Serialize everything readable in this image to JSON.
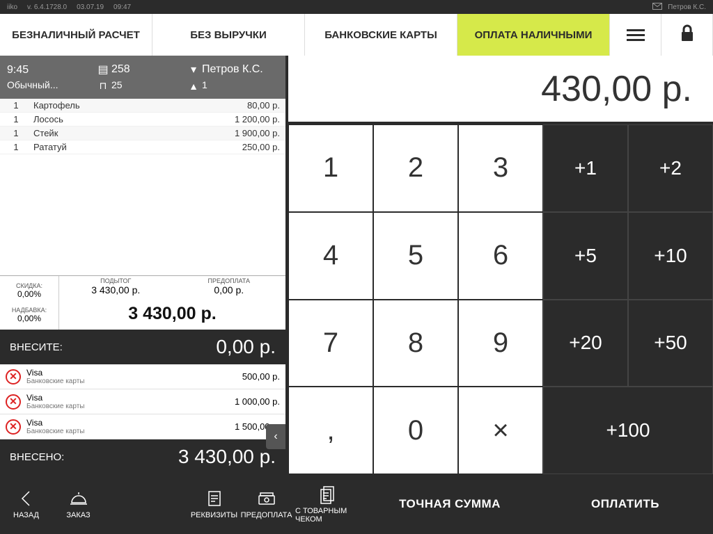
{
  "status": {
    "app": "iiko",
    "version": "v. 6.4.1728.0",
    "date": "03.07.19",
    "time": "09:47",
    "user": "Петров К.С."
  },
  "tabs": {
    "t0": "БЕЗНАЛИЧНЫЙ РАСЧЕТ",
    "t1": "БЕЗ ВЫРУЧКИ",
    "t2": "БАНКОВСКИЕ КАРТЫ",
    "t3": "ОПЛАТА НАЛИЧНЫМИ"
  },
  "order": {
    "time": "9:45",
    "type": "Обычный...",
    "check": "258",
    "table": "25",
    "waiter": "Петров К.С.",
    "guests": "1"
  },
  "items": [
    {
      "qty": "1",
      "name": "Картофель",
      "price": "80,00 р."
    },
    {
      "qty": "1",
      "name": "Лосось",
      "price": "1 200,00 р."
    },
    {
      "qty": "1",
      "name": "Стейк",
      "price": "1 900,00 р."
    },
    {
      "qty": "1",
      "name": "Рататуй",
      "price": "250,00 р."
    }
  ],
  "totals": {
    "discount_lbl": "СКИДКА:",
    "discount": "0,00%",
    "surcharge_lbl": "НАДБАВКА:",
    "surcharge": "0,00%",
    "subtotal_lbl": "ПОДЫТОГ",
    "subtotal": "3 430,00 р.",
    "prepay_lbl": "ПРЕДОПЛАТА",
    "prepay": "0,00 р.",
    "grand": "3 430,00 р."
  },
  "deposit": {
    "lbl": "ВНЕСИТЕ:",
    "val": "0,00 р."
  },
  "payments": [
    {
      "name": "Visa",
      "type": "Банковские карты",
      "value": "500,00 р."
    },
    {
      "name": "Visa",
      "type": "Банковские карты",
      "value": "1 000,00 р."
    },
    {
      "name": "Visa",
      "type": "Банковские карты",
      "value": "1 500,00 р."
    }
  ],
  "deposited": {
    "lbl": "ВНЕСЕНО:",
    "val": "3 430,00 р."
  },
  "amount": "430,00 р.",
  "keypad": {
    "d1": "1",
    "d2": "2",
    "d3": "3",
    "d4": "4",
    "d5": "5",
    "d6": "6",
    "d7": "7",
    "d8": "8",
    "d9": "9",
    "d0": "0",
    "comma": ",",
    "times": "×",
    "i1": "+1",
    "i2": "+2",
    "i5": "+5",
    "i10": "+10",
    "i20": "+20",
    "i50": "+50",
    "i100": "+100"
  },
  "footer": {
    "back": "НАЗАД",
    "order": "ЗАКАЗ",
    "req": "РЕКВИЗИТЫ",
    "prepay": "ПРЕДОПЛАТА",
    "receipt": "С ТОВАРНЫМ ЧЕКОМ",
    "exact": "ТОЧНАЯ СУММА",
    "pay": "ОПЛАТИТЬ"
  }
}
